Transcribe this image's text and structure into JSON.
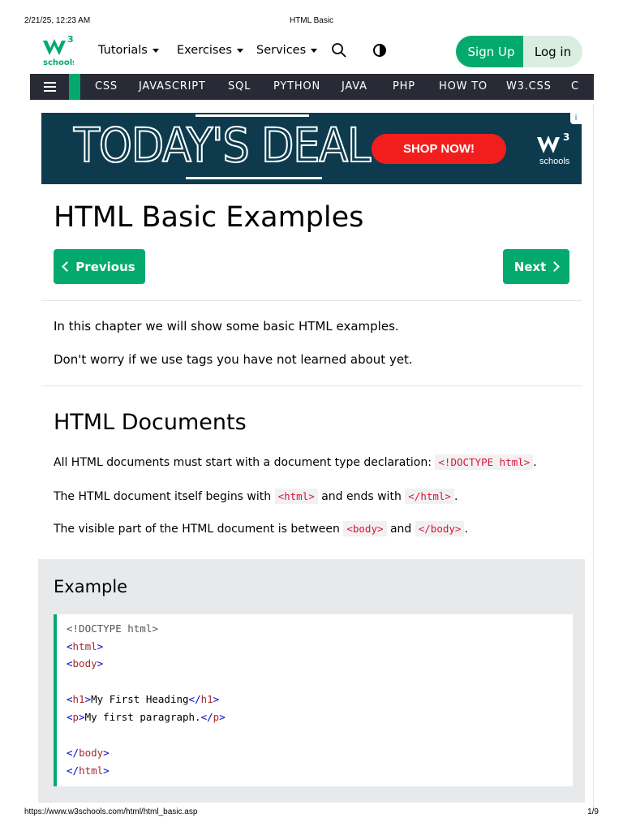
{
  "print_header": {
    "date": "2/21/25, 12:23 AM",
    "title": "HTML Basic"
  },
  "logo": {
    "mark": "w",
    "superscript": "3",
    "text": "schools"
  },
  "nav": {
    "tutorials": "Tutorials",
    "exercises": "Exercises",
    "services": "Services",
    "signup": "Sign Up",
    "login": "Log in"
  },
  "topics": [
    "CSS",
    "JAVASCRIPT",
    "SQL",
    "PYTHON",
    "JAVA",
    "PHP",
    "HOW TO",
    "W3.CSS",
    "C"
  ],
  "ad": {
    "headline": "TODAY'S DEAL",
    "cta": "SHOP NOW!",
    "logo_text": "schools",
    "logo_sup": "3",
    "info": "i"
  },
  "page": {
    "title": "HTML Basic Examples",
    "prev": "Previous",
    "next": "Next",
    "intro1": "In this chapter we will show some basic HTML examples.",
    "intro2": "Don't worry if we use tags you have not learned about yet."
  },
  "section": {
    "heading": "HTML Documents",
    "p1_a": "All HTML documents must start with a document type declaration:",
    "p1_code": "<!DOCTYPE html>",
    "p1_b": ".",
    "p2_a": "The HTML document itself begins with",
    "p2_code1": "<html>",
    "p2_b": "and ends with",
    "p2_code2": "</html>",
    "p2_c": ".",
    "p3_a": "The visible part of the HTML document is between",
    "p3_code1": "<body>",
    "p3_b": "and",
    "p3_code2": "</body>",
    "p3_c": "."
  },
  "example": {
    "heading": "Example",
    "doctype": "<!DOCTYPE html>",
    "tag_html": "html",
    "tag_body": "body",
    "tag_h1": "h1",
    "h1_text": "My First Heading",
    "tag_p": "p",
    "p_text": "My first paragraph.",
    "open": "<",
    "close": ">",
    "open_end": "</"
  },
  "print_footer": {
    "url": "https://www.w3schools.com/html/html_basic.asp",
    "page": "1/9"
  },
  "colors": {
    "brand_green": "#04aa6d",
    "topic_bar": "#282a35",
    "code_red": "#dc143c",
    "example_bg": "#e7e9eb"
  }
}
